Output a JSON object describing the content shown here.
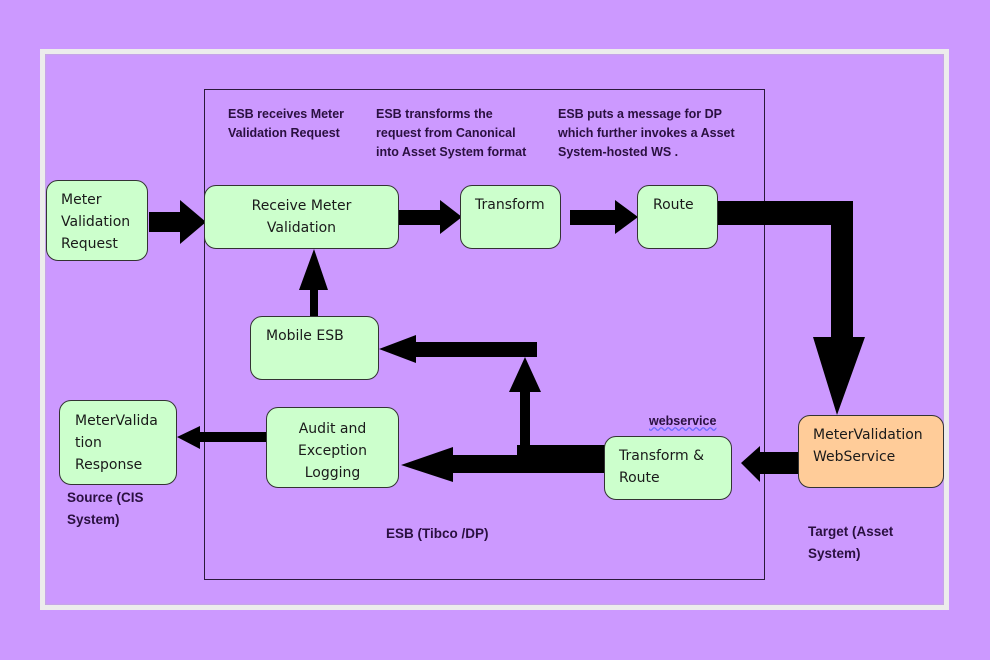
{
  "colors": {
    "background": "#cc99ff",
    "process_box": "#ccffcc",
    "target_box": "#ffcc99",
    "arrow": "#000000"
  },
  "notes": {
    "receive": "ESB receives Meter\nValidation Request",
    "transform": "ESB transforms the\nrequest from Canonical\ninto Asset System format",
    "route": "ESB puts a message for DP\nwhich further invokes a Asset\nSystem-hosted WS .",
    "webservice": "webservice",
    "source": "Source (CIS\nSystem)",
    "esb": "ESB (Tibco /DP)",
    "target": "Target (Asset\nSystem)"
  },
  "nodes": {
    "meter_validation_request": "Meter\nValidation\nRequest",
    "receive_meter_validation": "Receive Meter\nValidation",
    "transform": "Transform",
    "route": "Route",
    "mobile_esb": "Mobile ESB",
    "meter_validation_response": "MeterValida\ntion\nResponse",
    "audit_exception_logging": "Audit and\nException\nLogging",
    "transform_route": "Transform &\nRoute",
    "meter_validation_webservice": "MeterValidation\nWebService"
  }
}
